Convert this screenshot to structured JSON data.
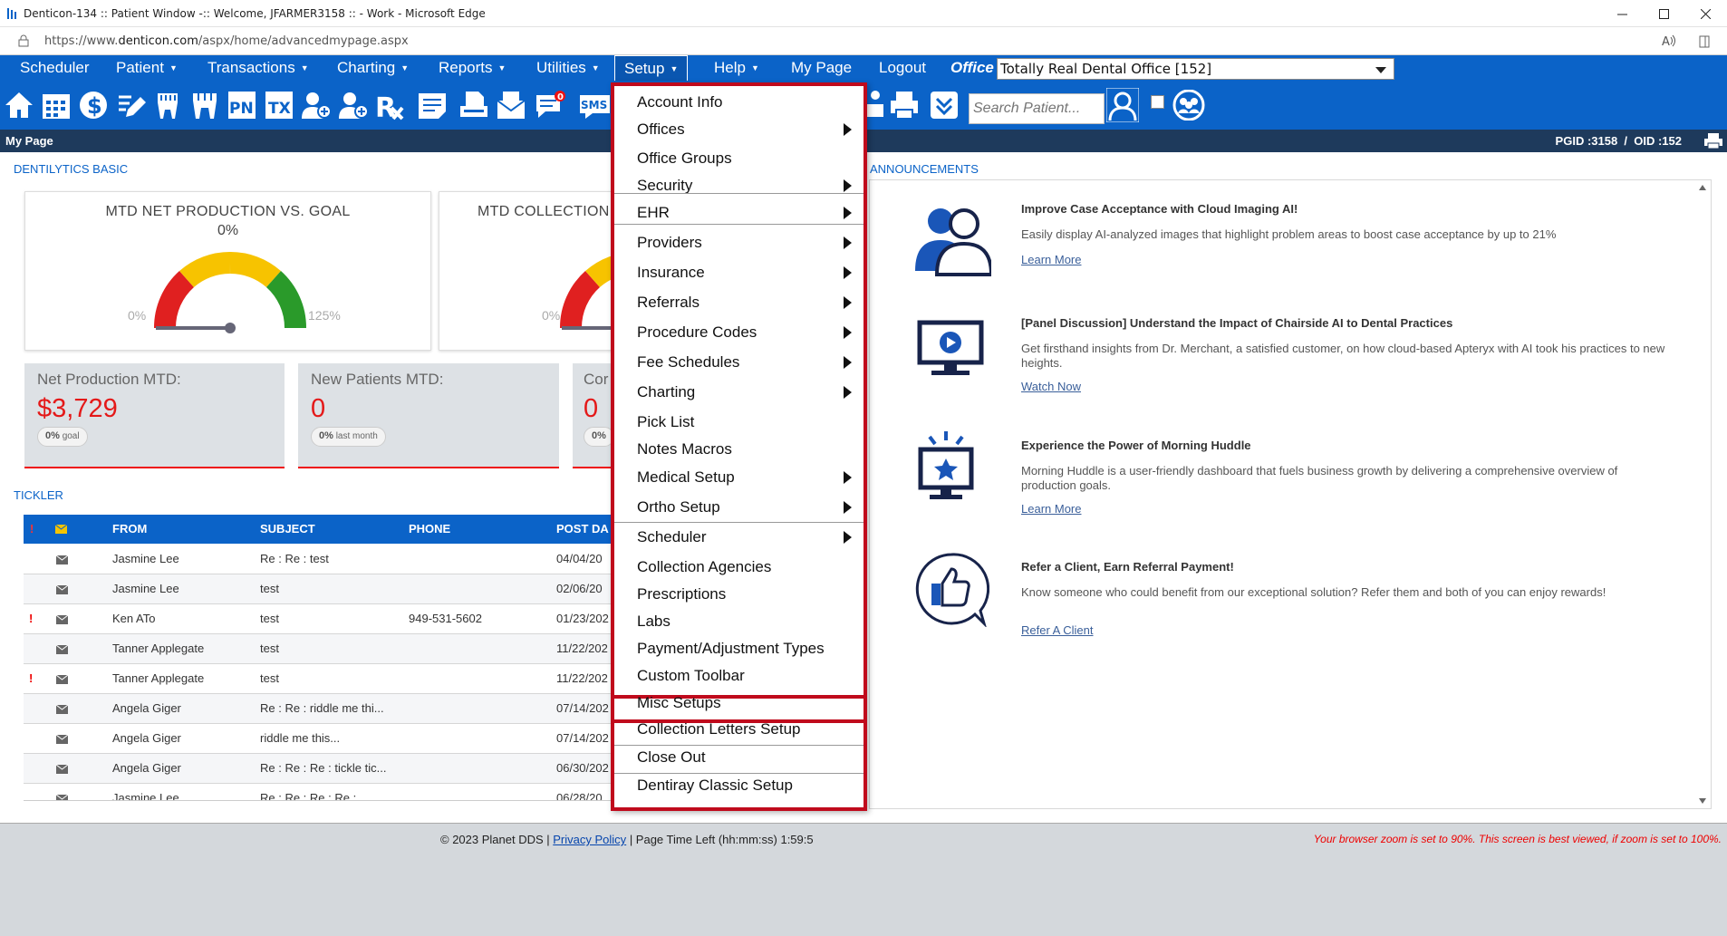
{
  "window": {
    "title": "Denticon-134 :: Patient Window -:: Welcome, JFARMER3158 :: - Work - Microsoft Edge",
    "url_prefix": "https://www.",
    "url_domain": "denticon.com",
    "url_path": "/aspx/home/advancedmypage.aspx"
  },
  "nav": {
    "items": [
      "Scheduler",
      "Patient",
      "Transactions",
      "Charting",
      "Reports",
      "Utilities",
      "Setup",
      "Help",
      "My Page",
      "Logout"
    ],
    "office_label": "Office",
    "office_value": "Totally Real Dental Office [152]",
    "caret": "▼"
  },
  "toolbar": {
    "icons": [
      "home-icon",
      "calendar-icon",
      "dollar-icon",
      "pen-icon",
      "tooth-icon",
      "teeth-icon",
      "pn-icon",
      "tx-icon",
      "patient-add-icon",
      "patient-plus-icon",
      "rx-icon",
      "note-icon",
      "print-doc-icon",
      "mail-icon",
      "message-icon",
      "sms-icon"
    ],
    "pn": "PN",
    "tx": "TX",
    "message_badge": "0",
    "sms": "SMS",
    "search_placeholder": "Search Patient..."
  },
  "subheader": {
    "left": "My Page",
    "right": "PGID :3158  /  OID :152"
  },
  "dentilytics": {
    "title": "DENTILYTICS BASIC",
    "gauges": [
      {
        "title": "MTD NET PRODUCTION VS. GOAL",
        "value": "0%",
        "min": "0%",
        "max": "125%",
        "needle_fraction": 0
      },
      {
        "title": "MTD COLLECTION",
        "value": "",
        "min": "0%",
        "max": "",
        "needle_fraction": 0
      }
    ],
    "kpis": [
      {
        "title": "Net Production MTD:",
        "value": "$3,729",
        "badge_value": "0%",
        "badge_text": "goal"
      },
      {
        "title": "New Patients MTD:",
        "value": "0",
        "badge_value": "0%",
        "badge_text": "last month"
      },
      {
        "title": "Cor",
        "value": "0",
        "badge_value": "0%",
        "badge_text": ""
      }
    ]
  },
  "tickler": {
    "title": "TICKLER",
    "headers": {
      "flag": "!",
      "from": "FROM",
      "subject": "SUBJECT",
      "phone": "PHONE",
      "post_date": "POST DA"
    },
    "rows": [
      {
        "flag": "",
        "from": "Jasmine Lee",
        "subject": "Re : Re : test",
        "phone": "",
        "post_date": "04/04/20"
      },
      {
        "flag": "",
        "from": "Jasmine Lee",
        "subject": "test",
        "phone": "",
        "post_date": "02/06/20"
      },
      {
        "flag": "!",
        "from": "Ken ATo",
        "subject": "test",
        "phone": "949-531-5602",
        "post_date": "01/23/202"
      },
      {
        "flag": "",
        "from": "Tanner Applegate",
        "subject": "test",
        "phone": "",
        "post_date": "11/22/202"
      },
      {
        "flag": "!",
        "from": "Tanner Applegate",
        "subject": "test",
        "phone": "",
        "post_date": "11/22/202"
      },
      {
        "flag": "",
        "from": "Angela Giger",
        "subject": "Re : Re : riddle me thi...",
        "phone": "",
        "post_date": "07/14/202"
      },
      {
        "flag": "",
        "from": "Angela Giger",
        "subject": "riddle me this...",
        "phone": "",
        "post_date": "07/14/202"
      },
      {
        "flag": "",
        "from": "Angela Giger",
        "subject": "Re : Re : Re : tickle tic...",
        "phone": "",
        "post_date": "06/30/202"
      },
      {
        "flag": "",
        "from": "Jasmine Lee",
        "subject": "Re : Re : Re : Re :",
        "phone": "",
        "post_date": "06/28/20"
      }
    ]
  },
  "announcements": {
    "title": "ANNOUNCEMENTS",
    "items": [
      {
        "icon": "people-icon",
        "heading": "Improve Case Acceptance with Cloud Imaging AI!",
        "body": "Easily display AI-analyzed images that highlight problem areas to boost case acceptance by up to 21%",
        "link": "Learn More"
      },
      {
        "icon": "monitor-play-icon",
        "heading": "[Panel Discussion] Understand the Impact of Chairside AI to Dental Practices",
        "body": "Get firsthand insights from Dr. Merchant, a satisfied customer, on how cloud-based Apteryx with AI took his practices to new heights.",
        "link": "Watch Now"
      },
      {
        "icon": "monitor-star-icon",
        "heading": "Experience the Power of Morning Huddle",
        "body": "Morning Huddle is a user-friendly dashboard that fuels business growth by delivering a comprehensive overview of production goals.",
        "link": "Learn More"
      },
      {
        "icon": "thumbs-up-icon",
        "heading": "Refer a Client, Earn Referral Payment!",
        "body": "Know someone who could benefit from our exceptional solution? Refer them and both of you can enjoy rewards!",
        "link": "Refer A Client"
      }
    ]
  },
  "footer": {
    "copyright": "© 2023 Planet DDS |",
    "privacy": "Privacy Policy",
    "time_left": "| Page Time Left (hh:mm:ss) 1:59:5",
    "zoom_warning": "Your browser zoom is set to 90%. This screen is best viewed, if zoom is set to 100%."
  },
  "setup_menu": {
    "items": [
      {
        "label": "Account Info",
        "submenu": false
      },
      {
        "label": "Offices",
        "submenu": true
      },
      {
        "label": "Office Groups",
        "submenu": false
      },
      {
        "label": "Security",
        "submenu": true
      },
      {
        "label": "EHR",
        "submenu": true
      },
      {
        "label": "Providers",
        "submenu": true
      },
      {
        "label": "Insurance",
        "submenu": true
      },
      {
        "label": "Referrals",
        "submenu": true
      },
      {
        "label": "Procedure Codes",
        "submenu": true
      },
      {
        "label": "Fee Schedules",
        "submenu": true
      },
      {
        "label": "Charting",
        "submenu": true
      },
      {
        "label": "Pick List",
        "submenu": false
      },
      {
        "label": "Notes Macros",
        "submenu": false
      },
      {
        "label": "Medical Setup",
        "submenu": true
      },
      {
        "label": "Ortho Setup",
        "submenu": true
      },
      {
        "label": "Scheduler",
        "submenu": true
      },
      {
        "label": "Collection Agencies",
        "submenu": false
      },
      {
        "label": "Prescriptions",
        "submenu": false
      },
      {
        "label": "Labs",
        "submenu": false
      },
      {
        "label": "Payment/Adjustment Types",
        "submenu": false
      },
      {
        "label": "Custom Toolbar",
        "submenu": false
      },
      {
        "label": "Misc Setups",
        "submenu": false
      },
      {
        "label": "Collection Letters Setup",
        "submenu": false
      },
      {
        "label": "Close Out",
        "submenu": false
      },
      {
        "label": "Dentiray Classic Setup",
        "submenu": false
      }
    ]
  },
  "colors": {
    "brand_blue": "#0b63c8",
    "header_dark": "#1e3a5c",
    "highlight_red": "#c00a1c",
    "kpi_red": "#e41919"
  }
}
